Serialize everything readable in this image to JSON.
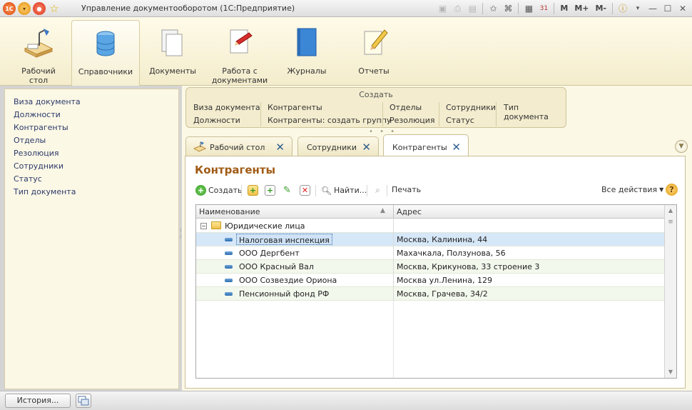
{
  "window": {
    "title": "Управление документооборотом  (1С:Предприятие)",
    "toolbar": {
      "m": "M",
      "mplus": "M+",
      "mminus": "M-",
      "calendar": "31"
    }
  },
  "sections": [
    {
      "label": "Рабочий\nстол",
      "icon": "desktop-icon"
    },
    {
      "label": "Справочники",
      "icon": "database-icon"
    },
    {
      "label": "Документы",
      "icon": "documents-icon"
    },
    {
      "label": "Работа с\nдокументами",
      "icon": "document-edit-icon"
    },
    {
      "label": "Журналы",
      "icon": "journal-icon"
    },
    {
      "label": "Отчеты",
      "icon": "report-icon"
    }
  ],
  "nav": {
    "items": [
      "Виза документа",
      "Должности",
      "Контрагенты",
      "Отделы",
      "Резолюция",
      "Сотрудники",
      "Статус",
      "Тип документа"
    ]
  },
  "create": {
    "title": "Создать",
    "col1": [
      "Виза документа",
      "Должности"
    ],
    "col2": [
      "Контрагенты",
      "Контрагенты: создать группу"
    ],
    "col3": [
      "Отделы",
      "Резолюция"
    ],
    "col4": [
      "Сотрудники",
      "Статус"
    ],
    "col5": [
      "Тип документа"
    ]
  },
  "tabs": [
    {
      "label": "Рабочий стол",
      "close": "✕"
    },
    {
      "label": "Сотрудники",
      "close": "✕"
    },
    {
      "label": "Контрагенты",
      "close": "✕"
    }
  ],
  "page": {
    "title": "Контрагенты",
    "commands": {
      "create": "Создать",
      "find": "Найти...",
      "print": "Печать",
      "all_actions": "Все действия",
      "help": "?"
    }
  },
  "table": {
    "columns": [
      "Наименование",
      "Адрес"
    ],
    "group": "Юридические лица",
    "rows": [
      {
        "name": "Налоговая инспекция",
        "address": "Москва, Калинина, 44"
      },
      {
        "name": "ООО Дергбент",
        "address": "Махачкала, Ползунова, 56"
      },
      {
        "name": "ООО Красный Вал",
        "address": "Москва, Крикунова, 33 строение 3"
      },
      {
        "name": "ООО Созвездие Ориона",
        "address": "Москва ул.Ленина, 129"
      },
      {
        "name": "Пенсионный фонд РФ",
        "address": "Москва, Грачева, 34/2"
      }
    ]
  },
  "status": {
    "history_button": "История..."
  },
  "colors": {
    "accent_title": "#a05a14",
    "selection": "#d6e7f8",
    "panel_bg": "#fcf8e6"
  }
}
